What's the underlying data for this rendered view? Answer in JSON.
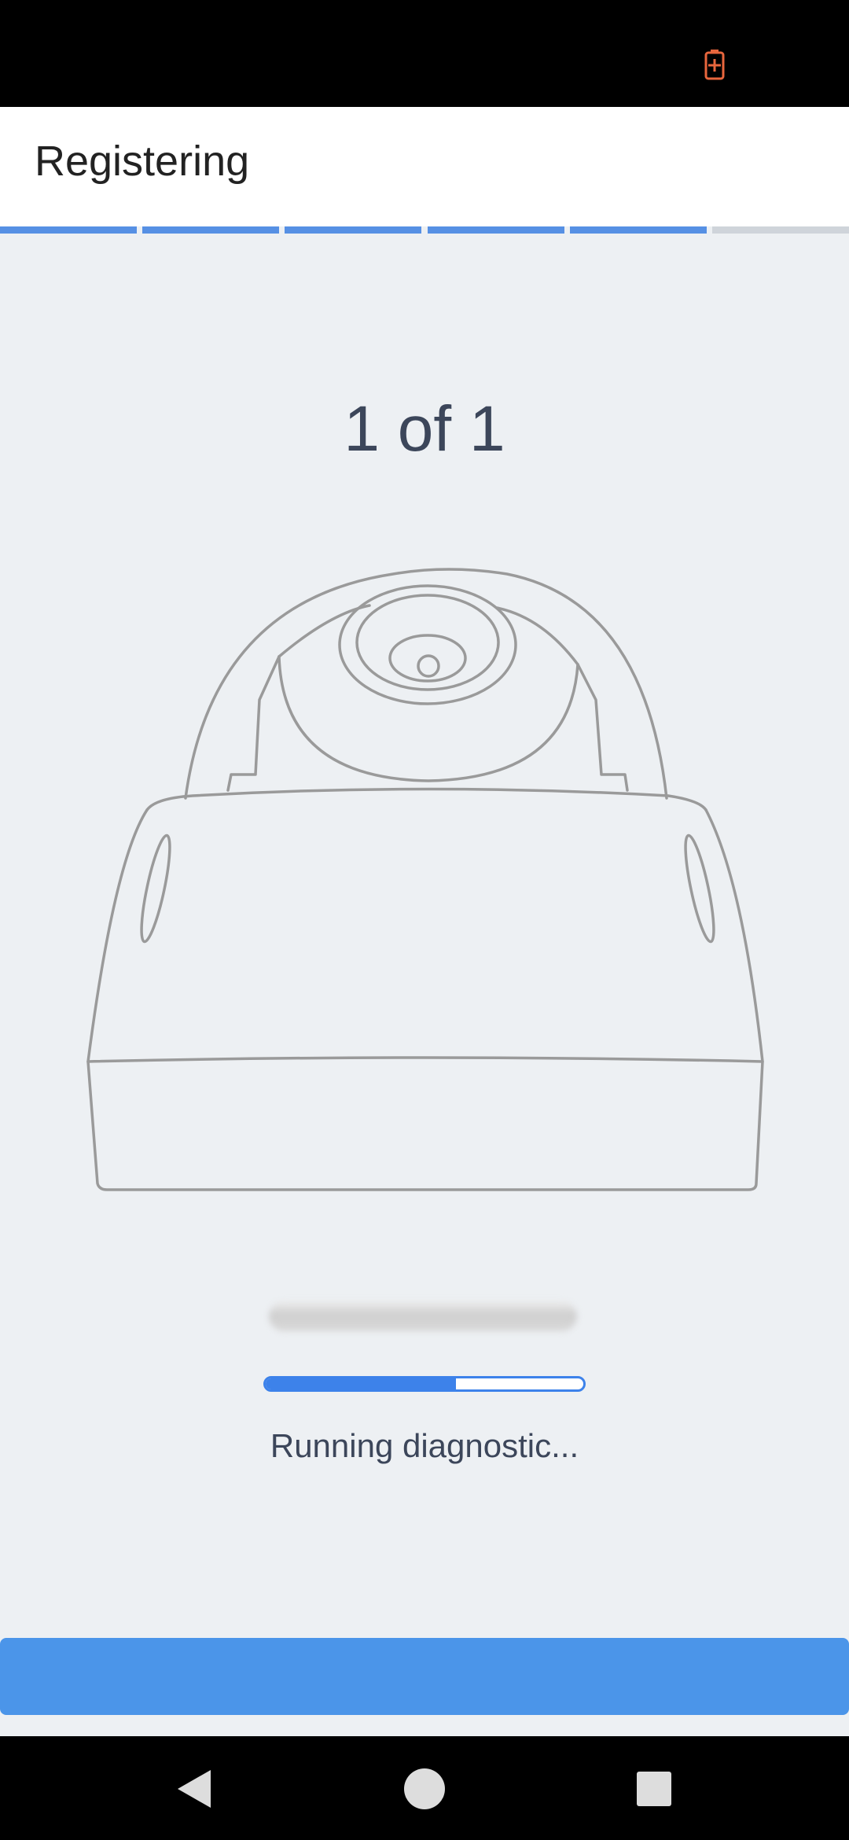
{
  "status_bar": {
    "battery_icon": "battery-charging-icon"
  },
  "header": {
    "title": "Registering"
  },
  "steps": {
    "total": 6,
    "completed": 5,
    "done_color": "#5690e4",
    "todo_color": "#cfd4da"
  },
  "main": {
    "counter": "1 of 1",
    "camera_image": "dome-camera-illustration",
    "device_name": "",
    "progress_fraction": 0.6,
    "status": "Running diagnostic..."
  },
  "action": {
    "label": ""
  },
  "nav": {
    "back_icon": "back-icon",
    "home_icon": "home-icon",
    "recents_icon": "recents-icon"
  }
}
